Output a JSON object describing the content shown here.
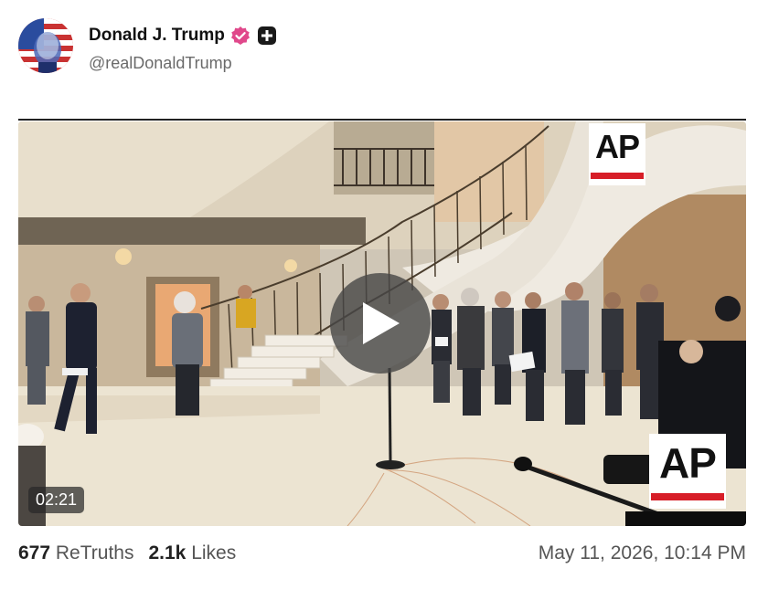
{
  "author": {
    "display_name": "Donald J. Trump",
    "handle": "@realDonaldTrump",
    "avatar_icon": "flag-portrait-avatar",
    "verified_icon": "verified-badge-icon",
    "plus_icon": "plus-badge-icon"
  },
  "media": {
    "duration": "02:21",
    "watermark": "AP",
    "play_icon": "play-icon"
  },
  "stats": {
    "retruths_count": "677",
    "retruths_label": "ReTruths",
    "likes_count": "2.1k",
    "likes_label": "Likes"
  },
  "timestamp": "May 11, 2026, 10:14 PM",
  "colors": {
    "verified": "#e0488b",
    "ap_red": "#d71e28",
    "text_muted": "#555555"
  }
}
